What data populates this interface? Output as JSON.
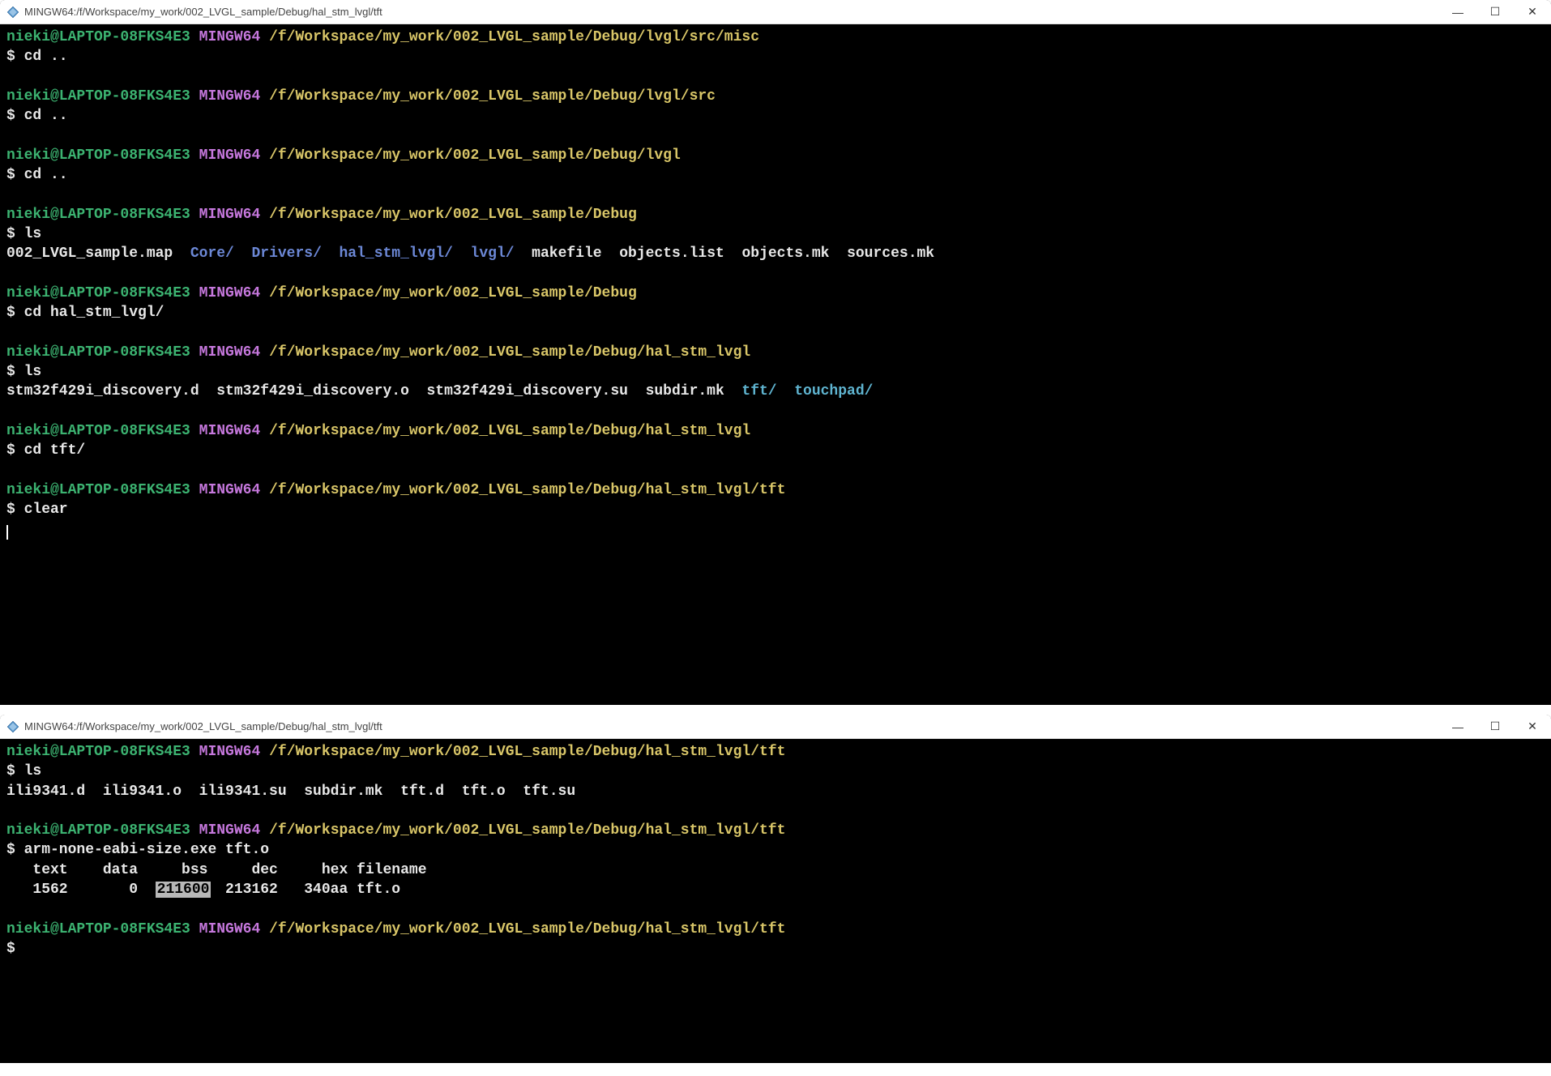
{
  "window1": {
    "title": "MINGW64:/f/Workspace/my_work/002_LVGL_sample/Debug/hal_stm_lvgl/tft",
    "blocks": [
      {
        "user": "nieki@LAPTOP-08FKS4E3",
        "env": "MINGW64",
        "path": "/f/Workspace/my_work/002_LVGL_sample/Debug/lvgl/src/misc",
        "cmd": "cd .."
      },
      {
        "user": "nieki@LAPTOP-08FKS4E3",
        "env": "MINGW64",
        "path": "/f/Workspace/my_work/002_LVGL_sample/Debug/lvgl/src",
        "cmd": "cd .."
      },
      {
        "user": "nieki@LAPTOP-08FKS4E3",
        "env": "MINGW64",
        "path": "/f/Workspace/my_work/002_LVGL_sample/Debug/lvgl",
        "cmd": "cd .."
      },
      {
        "user": "nieki@LAPTOP-08FKS4E3",
        "env": "MINGW64",
        "path": "/f/Workspace/my_work/002_LVGL_sample/Debug",
        "cmd": "ls",
        "output_items": [
          {
            "text": "002_LVGL_sample.map",
            "cls": "c-white"
          },
          {
            "text": "  ",
            "cls": ""
          },
          {
            "text": "Core/",
            "cls": "c-blue"
          },
          {
            "text": "  ",
            "cls": ""
          },
          {
            "text": "Drivers/",
            "cls": "c-blue"
          },
          {
            "text": "  ",
            "cls": ""
          },
          {
            "text": "hal_stm_lvgl/",
            "cls": "c-blue"
          },
          {
            "text": "  ",
            "cls": ""
          },
          {
            "text": "lvgl/",
            "cls": "c-blue"
          },
          {
            "text": "  ",
            "cls": ""
          },
          {
            "text": "makefile",
            "cls": "c-white"
          },
          {
            "text": "  ",
            "cls": ""
          },
          {
            "text": "objects.list",
            "cls": "c-white"
          },
          {
            "text": "  ",
            "cls": ""
          },
          {
            "text": "objects.mk",
            "cls": "c-white"
          },
          {
            "text": "  ",
            "cls": ""
          },
          {
            "text": "sources.mk",
            "cls": "c-white"
          }
        ]
      },
      {
        "user": "nieki@LAPTOP-08FKS4E3",
        "env": "MINGW64",
        "path": "/f/Workspace/my_work/002_LVGL_sample/Debug",
        "cmd": "cd hal_stm_lvgl/"
      },
      {
        "user": "nieki@LAPTOP-08FKS4E3",
        "env": "MINGW64",
        "path": "/f/Workspace/my_work/002_LVGL_sample/Debug/hal_stm_lvgl",
        "cmd": "ls",
        "output_items": [
          {
            "text": "stm32f429i_discovery.d",
            "cls": "c-white"
          },
          {
            "text": "  ",
            "cls": ""
          },
          {
            "text": "stm32f429i_discovery.o",
            "cls": "c-white"
          },
          {
            "text": "  ",
            "cls": ""
          },
          {
            "text": "stm32f429i_discovery.su",
            "cls": "c-white"
          },
          {
            "text": "  ",
            "cls": ""
          },
          {
            "text": "subdir.mk",
            "cls": "c-white"
          },
          {
            "text": "  ",
            "cls": ""
          },
          {
            "text": "tft/",
            "cls": "c-cyan"
          },
          {
            "text": "  ",
            "cls": ""
          },
          {
            "text": "touchpad/",
            "cls": "c-cyan"
          }
        ]
      },
      {
        "user": "nieki@LAPTOP-08FKS4E3",
        "env": "MINGW64",
        "path": "/f/Workspace/my_work/002_LVGL_sample/Debug/hal_stm_lvgl",
        "cmd": "cd tft/"
      },
      {
        "user": "nieki@LAPTOP-08FKS4E3",
        "env": "MINGW64",
        "path": "/f/Workspace/my_work/002_LVGL_sample/Debug/hal_stm_lvgl/tft",
        "cmd": "clear"
      }
    ]
  },
  "window2": {
    "title": "MINGW64:/f/Workspace/my_work/002_LVGL_sample/Debug/hal_stm_lvgl/tft",
    "prompt1": {
      "user": "nieki@LAPTOP-08FKS4E3",
      "env": "MINGW64",
      "path": "/f/Workspace/my_work/002_LVGL_sample/Debug/hal_stm_lvgl/tft",
      "cmd": "ls",
      "output": "ili9341.d  ili9341.o  ili9341.su  subdir.mk  tft.d  tft.o  tft.su"
    },
    "prompt2": {
      "user": "nieki@LAPTOP-08FKS4E3",
      "env": "MINGW64",
      "path": "/f/Workspace/my_work/002_LVGL_sample/Debug/hal_stm_lvgl/tft",
      "cmd": "arm-none-eabi-size.exe tft.o",
      "header": "   text\t   data\t    bss\t    dec\t    hex\tfilename",
      "row_pre": "   1562\t      0\t ",
      "row_highlight": "211600",
      "row_post": "\t 213162\t  340aa\ttft.o"
    },
    "prompt3": {
      "user": "nieki@LAPTOP-08FKS4E3",
      "env": "MINGW64",
      "path": "/f/Workspace/my_work/002_LVGL_sample/Debug/hal_stm_lvgl/tft",
      "cmd": ""
    }
  },
  "controls": {
    "minimize": "—",
    "maximize": "☐",
    "close": "✕"
  }
}
